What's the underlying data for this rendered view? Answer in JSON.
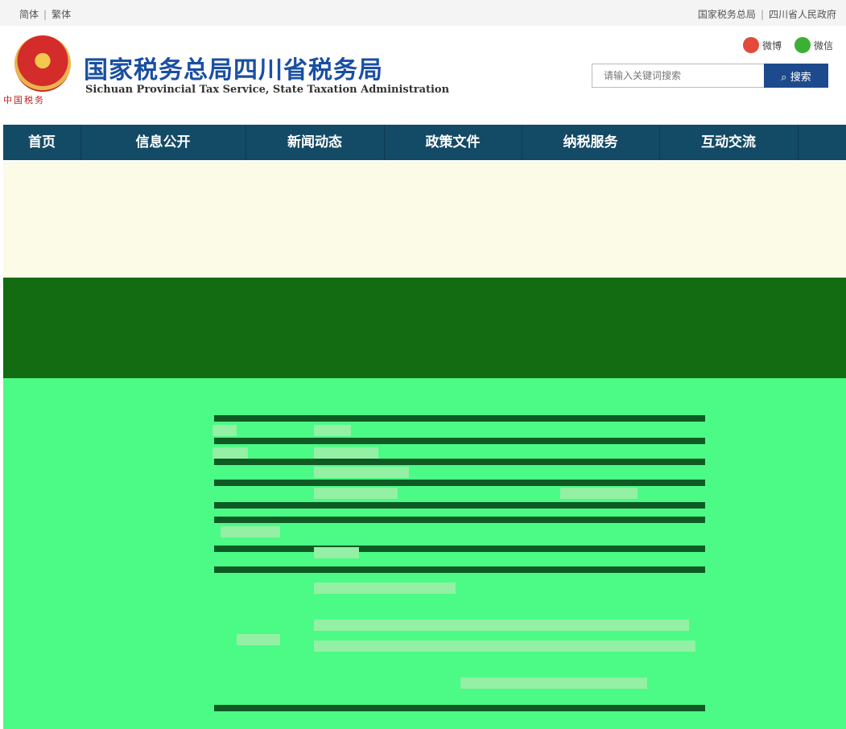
{
  "topbar": {
    "simplified": "简体",
    "traditional": "繁体",
    "link_sat": "国家税务总局",
    "link_gov": "四川省人民政府",
    "sep": "|"
  },
  "header": {
    "title_cn": "国家税务总局四川省税务局",
    "title_en": "Sichuan Provincial Tax Service, State Taxation Administration",
    "emblem_ribbon": "中国税务",
    "weibo": "微博",
    "wechat": "微信",
    "search_placeholder": "请输入关键词搜索",
    "search_button": "搜索"
  },
  "nav": {
    "items": [
      "首页",
      "信息公开",
      "新闻动态",
      "政策文件",
      "纳税服务",
      "互动交流"
    ]
  },
  "colors": {
    "nav_bg": "#134a66",
    "brand_blue": "#1a4fa3",
    "search_btn": "#1d4a8c",
    "banner_bg": "#fbfbe7",
    "dark_band": "#136b12",
    "green_area": "#4cfa86"
  }
}
